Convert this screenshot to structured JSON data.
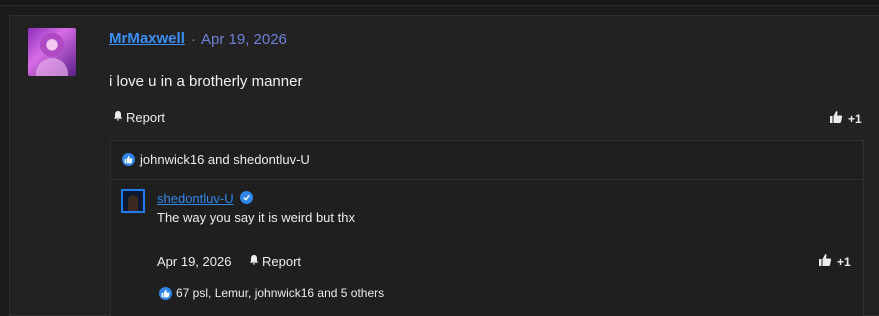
{
  "post": {
    "author": "MrMaxwell",
    "separator": "·",
    "date": "Apr 19, 2026",
    "message": "i love u in a brotherly manner",
    "report_label": "Report",
    "like_count": "+1",
    "reactions_text": "johnwick16 and shedontluv-U"
  },
  "reply": {
    "author": "shedontluv-U",
    "text": "The way you say it is weird but thx",
    "date": "Apr 19, 2026",
    "report_label": "Report",
    "like_count": "+1",
    "reactions_text": "67 psl, Lemur, johnwick16 and 5 others"
  },
  "colors": {
    "background": "#1b1b1b",
    "panel": "#222222",
    "accent": "#2f86ea",
    "author_link": "#3b8ff5",
    "date": "#6e80d6"
  }
}
